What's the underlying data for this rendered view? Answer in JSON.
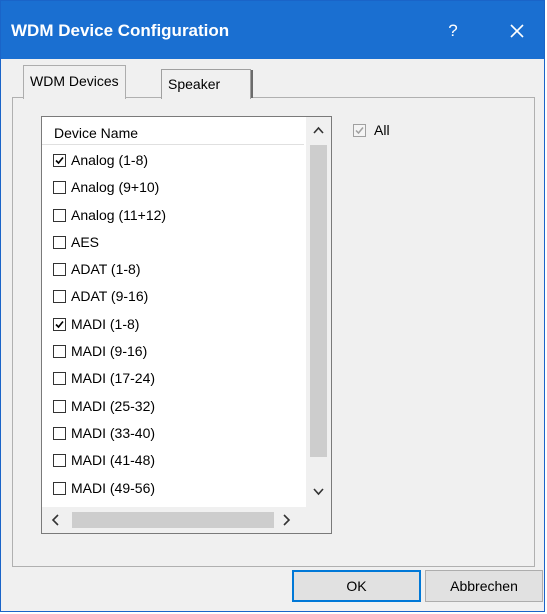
{
  "window": {
    "title": "WDM Device Configuration",
    "help_glyph": "?"
  },
  "tabs": [
    {
      "label": "WDM Devices"
    },
    {
      "label": "Speaker"
    }
  ],
  "list": {
    "header": "Device Name",
    "items": [
      {
        "label": "Analog (1-8)",
        "checked": true
      },
      {
        "label": "Analog (9+10)",
        "checked": false
      },
      {
        "label": "Analog (11+12)",
        "checked": false
      },
      {
        "label": "AES",
        "checked": false
      },
      {
        "label": "ADAT (1-8)",
        "checked": false
      },
      {
        "label": "ADAT (9-16)",
        "checked": false
      },
      {
        "label": "MADI (1-8)",
        "checked": true
      },
      {
        "label": "MADI (9-16)",
        "checked": false
      },
      {
        "label": "MADI (17-24)",
        "checked": false
      },
      {
        "label": "MADI (25-32)",
        "checked": false
      },
      {
        "label": "MADI (33-40)",
        "checked": false
      },
      {
        "label": "MADI (41-48)",
        "checked": false
      },
      {
        "label": "MADI (49-56)",
        "checked": false
      }
    ]
  },
  "all_checkbox": {
    "label": "All",
    "checked": true,
    "disabled": true
  },
  "buttons": {
    "ok": "OK",
    "cancel": "Abbrechen"
  }
}
